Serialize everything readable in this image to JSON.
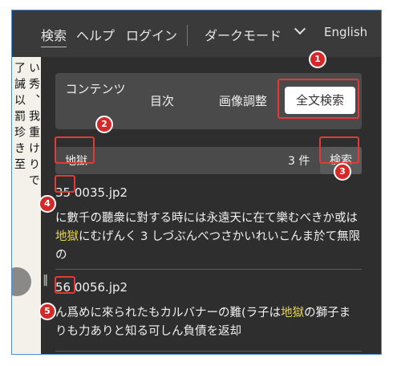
{
  "nav": {
    "search": "検索",
    "help": "ヘルプ",
    "login": "ログイン",
    "dark_mode": "ダークモード",
    "language": "English"
  },
  "scan": {
    "col1": "了誡以罰珍き至",
    "col2": "い秀、我重けりで"
  },
  "tabs": {
    "contents": "コンテンツ",
    "toc": "目次",
    "image_adjust": "画像調整",
    "fulltext": "全文検索"
  },
  "search": {
    "term": "地獄",
    "count": "3 件",
    "button": "検索"
  },
  "results": [
    {
      "page": "35",
      "file": "0035.jp2",
      "before": "に數千の聽衆に對する時には永遠天に在て樂むべきか或は",
      "highlight": "地獄",
      "after": "にむげんく 3 しづぶんべつさかいれいこんま於て無限の"
    },
    {
      "page": "56",
      "file": "0056.jp2",
      "before": "ん爲めに來られたもカルバナーの難(ラ子は",
      "highlight": "地獄",
      "after": "の獅子まりも力ありと知る可しん負債を返却"
    }
  ],
  "badges": [
    "1",
    "2",
    "3",
    "4",
    "5"
  ],
  "colors": {
    "annotation": "#e53935",
    "highlight": "#e8d44d",
    "panel_bg": "#2e2e2e"
  }
}
